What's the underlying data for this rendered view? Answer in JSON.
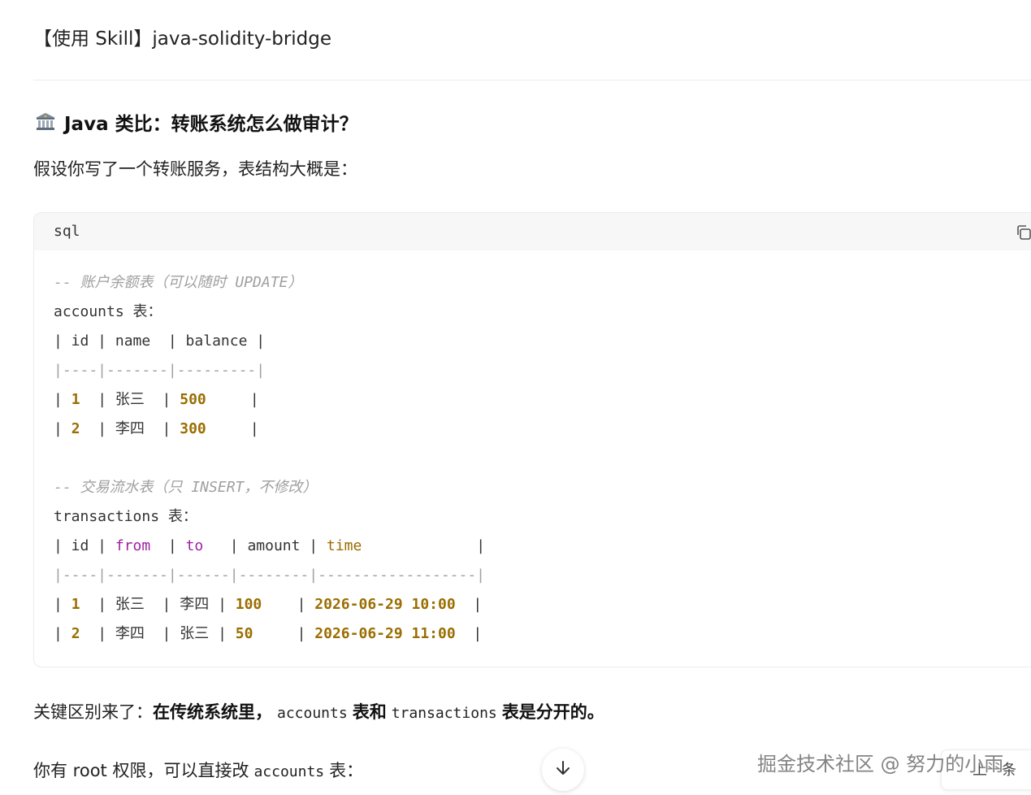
{
  "message": {
    "skill_line": "【使用 Skill】java-solidity-bridge",
    "heading": "Java 类比：转账系统怎么做审计？",
    "intro": "假设你写了一个转账服务，表结构大概是：",
    "key_diff": {
      "prefix": "关键区别来了：",
      "bold_start": "在传统系统里，",
      "code1": "accounts",
      "mid": "表和",
      "code2": "transactions",
      "bold_end": "表是分开的。",
      "tail": "。"
    },
    "root_line": {
      "prefix": "你有 root 权限，可以直接改",
      "code": "accounts",
      "suffix": "表："
    }
  },
  "code_block": {
    "language": "sql",
    "lines": {
      "c1": "-- 账户余额表（可以随时 UPDATE）",
      "t1": "accounts 表：",
      "t1_header": "| id | name  | balance |",
      "t1_sep": "|----|-------|---------|",
      "t1_r1_a": "| ",
      "t1_r1_id": "1",
      "t1_r1_b": "  | 张三  | ",
      "t1_r1_bal": "500",
      "t1_r1_c": "     |",
      "t1_r2_a": "| ",
      "t1_r2_id": "2",
      "t1_r2_b": "  | 李四  | ",
      "t1_r2_bal": "300",
      "t1_r2_c": "     |",
      "c2": "-- 交易流水表（只 INSERT，不修改）",
      "t2": "transactions 表：",
      "t2_h_a": "| id | ",
      "t2_h_from": "from",
      "t2_h_b": "  | ",
      "t2_h_to": "to",
      "t2_h_c": "   | amount | ",
      "t2_h_time": "time",
      "t2_h_d": "             |",
      "t2_sep": "|----|-------|------|--------|------------------|",
      "t2_r1_a": "| ",
      "t2_r1_id": "1",
      "t2_r1_b": "  | 张三  | 李四 | ",
      "t2_r1_amt": "100",
      "t2_r1_c": "    | ",
      "t2_r1_time": "2026-06-29 10:00",
      "t2_r1_d": "  |",
      "t2_r2_a": "| ",
      "t2_r2_id": "2",
      "t2_r2_b": "  | 李四  | 张三 | ",
      "t2_r2_amt": "50",
      "t2_r2_c": "     | ",
      "t2_r2_time": "2026-06-29 11:00",
      "t2_r2_d": "  |"
    }
  },
  "watermark": "掘金技术社区 @ 努力的小雨",
  "next_label": "上一条",
  "icons": {
    "bank": "bank-icon",
    "copy": "copy-icon",
    "scroll_down": "arrow-down-icon"
  }
}
